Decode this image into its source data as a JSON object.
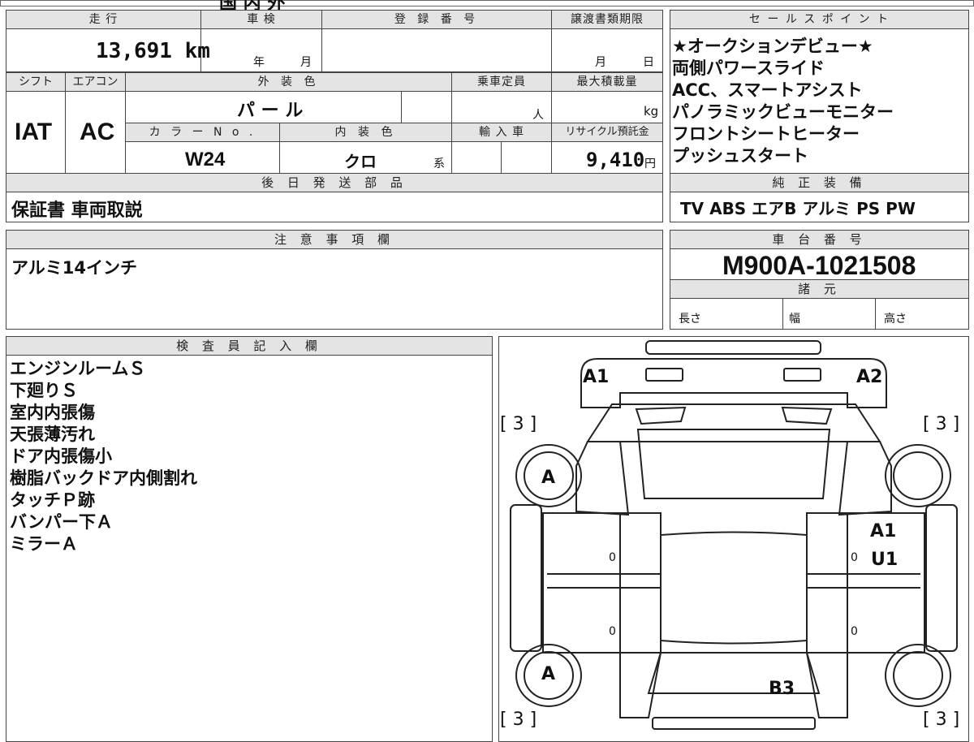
{
  "top_strip": {
    "partial": "国 内 外"
  },
  "labels": {
    "mileage": "走 行",
    "inspection": "車 検",
    "registration_no": "登 録 番 号",
    "transfer_deadline": "譲渡書類期限",
    "sales_points": "セ ー ル ス ポ イ ン ト",
    "shift": "シフト",
    "aircon": "エアコン",
    "exterior_color": "外 装 色",
    "capacity": "乗車定員",
    "max_load": "最大積載量",
    "color_no": "カ ラ ー N o .",
    "interior_color": "内 装 色",
    "import": "輸 入 車",
    "recycle": "リサイクル預託金",
    "later_parts": "後 日 発 送 部 品",
    "genuine_equipment": "純 正 装 備",
    "notes": "注 意 事 項 欄",
    "chassis_no": "車 台 番 号",
    "specs": "諸 元",
    "length": "長さ",
    "width": "幅",
    "height": "高さ",
    "inspector": "検 査 員 記 入 欄"
  },
  "units": {
    "year": "年",
    "month": "月",
    "day": "日",
    "person": "人",
    "kg": "kg",
    "yen": "円",
    "series": "系"
  },
  "values": {
    "mileage": "13,691 km",
    "shift": "IAT",
    "aircon": "AC",
    "exterior_color": "パ ー ル",
    "color_no": "W24",
    "interior_color": "クロ",
    "recycle_fee": "9,410",
    "later_parts": "保証書 車両取説",
    "genuine_equipment": "TV ABS エアB アルミ PS PW",
    "notes": "アルミ14インチ",
    "chassis_no": "M900A-1021508"
  },
  "sales_points": [
    "★オークションデビュー★",
    "両側パワースライド",
    "ACC、スマートアシスト",
    "パノラミックビューモニター",
    "フロントシートヒーター",
    "プッシュスタート"
  ],
  "inspector_notes": [
    "エンジンルームＳ",
    "下廻りＳ",
    "室内内張傷",
    "天張薄汚れ",
    "ドア内張傷小",
    "樹脂バックドア内側割れ",
    "タッチＰ跡",
    "バンパー下Ａ",
    "ミラーＡ"
  ],
  "diagram": {
    "mark_a1_left": "A1",
    "mark_a2_right": "A2",
    "tire_front_left": "A",
    "tire_rear_left": "A",
    "tread_fl": "[ 3 ]",
    "tread_fr": "[ 3 ]",
    "tread_rl": "[ 3 ]",
    "tread_rr": "[ 3 ]",
    "right_front_door_a": "A1",
    "right_front_door_u": "U1",
    "rear_b3": "B3",
    "door_zero": "0"
  }
}
